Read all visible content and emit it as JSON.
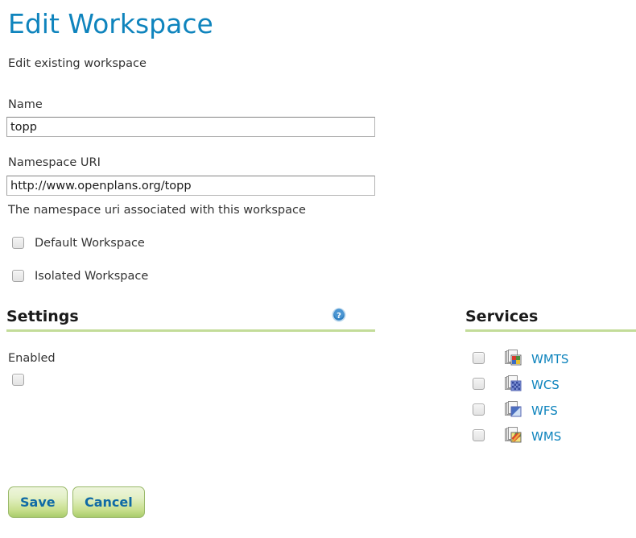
{
  "header": {
    "title": "Edit Workspace",
    "subtitle": "Edit existing workspace",
    "title_color": "#0f84bd"
  },
  "form": {
    "name": {
      "label": "Name",
      "value": "topp",
      "placeholder": ""
    },
    "namespace": {
      "label": "Namespace URI",
      "value": "http://www.openplans.org/topp",
      "placeholder": "",
      "help": "The namespace uri associated with this workspace"
    },
    "checkboxes": [
      {
        "label": "Default Workspace",
        "checked": false
      },
      {
        "label": "Isolated Workspace",
        "checked": false
      }
    ]
  },
  "settings": {
    "title": "Settings",
    "help_icon": "help-circle-icon",
    "enabled": {
      "label": "Enabled",
      "checked": false
    },
    "rule_color": "#c3dc99"
  },
  "services": {
    "title": "Services",
    "rule_color": "#c3dc99",
    "items": [
      {
        "label": "WMTS",
        "checked": false,
        "icon": "wmts-service-icon"
      },
      {
        "label": "WCS",
        "checked": false,
        "icon": "wcs-service-icon"
      },
      {
        "label": "WFS",
        "checked": false,
        "icon": "wfs-service-icon"
      },
      {
        "label": "WMS",
        "checked": false,
        "icon": "wms-service-icon"
      }
    ]
  },
  "actions": {
    "save_label": "Save",
    "cancel_label": "Cancel",
    "button_text_color": "#0f6aa5"
  }
}
